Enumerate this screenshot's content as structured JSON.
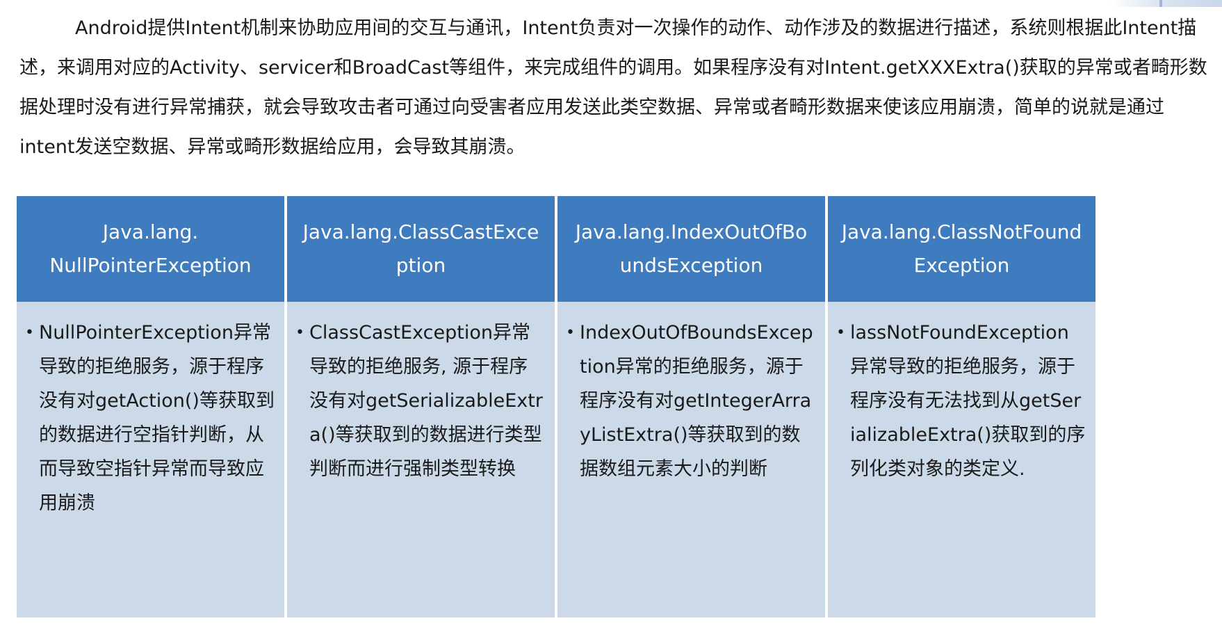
{
  "intro": {
    "paragraph": "Android提供Intent机制来协助应用间的交互与通讯，Intent负责对一次操作的动作、动作涉及的数据进行描述，系统则根据此Intent描述，来调用对应的Activity、servicer和BroadCast等组件，来完成组件的调用。如果程序没有对Intent.getXXXExtra()获取的异常或者畸形数据处理时没有进行异常捕获，就会导致攻击者可通过向受害者应用发送此类空数据、异常或者畸形数据来使该应用崩溃，简单的说就是通过intent发送空数据、异常或畸形数据给应用，会导致其崩溃。"
  },
  "cards": [
    {
      "title": "Java.lang.\nNullPointerException",
      "body": "NullPointerException异常导致的拒绝服务，源于程序没有对getAction()等获取到的数据进行空指针判断，从而导致空指针异常而导致应用崩溃"
    },
    {
      "title": "Java.lang.ClassCastException",
      "body": "ClassCastException异常导致的拒绝服务, 源于程序没有对getSerializableExtra()等获取到的数据进行类型判断而进行强制类型转换"
    },
    {
      "title": "Java.lang.IndexOutOfBoundsException",
      "body": "IndexOutOfBoundsException异常的拒绝服务，源于程序没有对getIntegerArrayListExtra()等获取到的数据数组元素大小的判断"
    },
    {
      "title": "Java.lang.ClassNotFoundException",
      "body": "lassNotFoundException异常导致的拒绝服务，源于程序没有无法找到从getSerializableExtra()获取到的序列化类对象的类定义."
    }
  ],
  "bullet_symbol": "•",
  "colors": {
    "header_blue": "#3f7bbf",
    "body_blue": "#ccd9e8"
  }
}
